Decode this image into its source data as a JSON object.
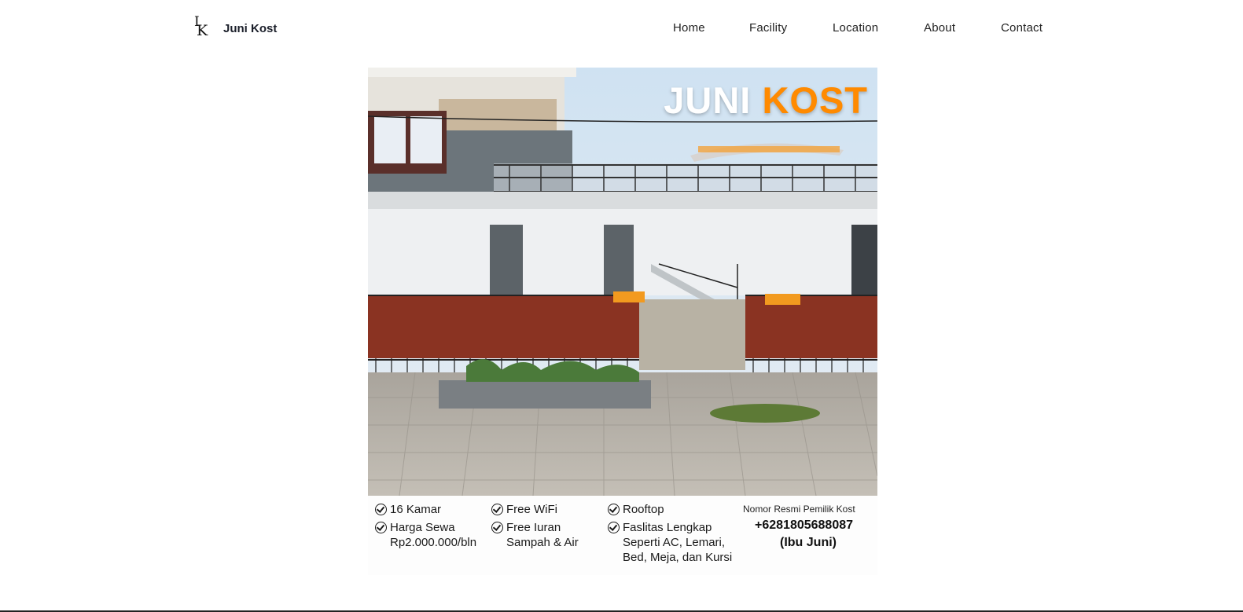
{
  "brand": {
    "logo_text_top": "I",
    "logo_text_bottom": "K",
    "name": "Juni Kost"
  },
  "nav": {
    "items": [
      {
        "label": "Home"
      },
      {
        "label": "Facility"
      },
      {
        "label": "Location"
      },
      {
        "label": "About"
      },
      {
        "label": "Contact"
      }
    ]
  },
  "poster": {
    "title_white": "JUNI",
    "title_orange": "KOST",
    "features": [
      {
        "lines": [
          "16 Kamar"
        ]
      },
      {
        "lines": [
          "Harga Sewa",
          "Rp2.000.000/bln"
        ]
      },
      {
        "lines": [
          "Free WiFi"
        ]
      },
      {
        "lines": [
          "Free Iuran",
          "Sampah & Air"
        ]
      },
      {
        "lines": [
          "Rooftop"
        ]
      },
      {
        "lines": [
          "Faslitas Lengkap",
          "Seperti AC, Lemari,",
          "Bed, Meja, dan Kursi"
        ]
      }
    ],
    "owner_label": "Nomor Resmi Pemilik Kost",
    "owner_phone": "+6281805688087",
    "owner_name": "(Ibu Juni)"
  },
  "colors": {
    "accent": "#ff8a00",
    "text": "#1b1f2a",
    "fence": "#8a3322"
  }
}
